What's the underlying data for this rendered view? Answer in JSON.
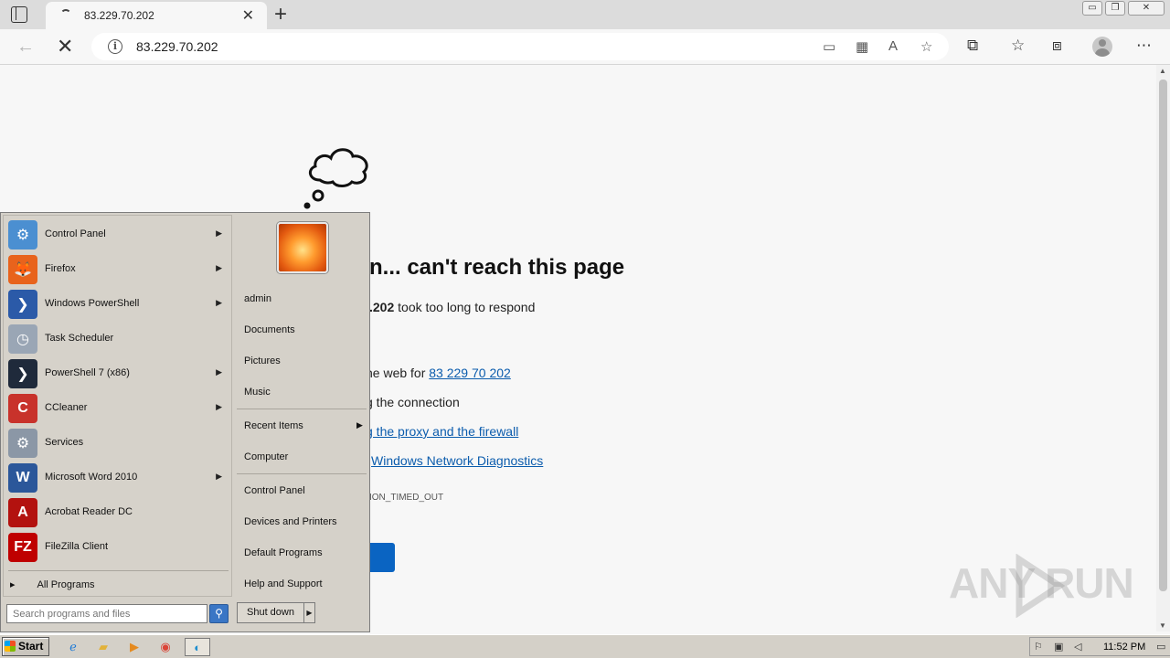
{
  "browser": {
    "tab_title": "83.229.70.202",
    "tab_close": "✕",
    "new_tab": "+",
    "url": "83.229.70.202",
    "window_controls": [
      "▭",
      "❐",
      "✕"
    ]
  },
  "page": {
    "heading": "n... can't reach this page",
    "line1_bold": ".202",
    "line1_rest": " took too long to respond",
    "search_prefix": "ne web for ",
    "search_link": "83 229 70 202",
    "check_connection": "g the connection",
    "proxy_link": "g the proxy and the firewall",
    "diag_link": "Windows Network Diagnostics",
    "error_code": "ION_TIMED_OUT"
  },
  "watermark": "ANY RUN",
  "start_menu": {
    "programs": [
      {
        "label": "Control Panel",
        "icon": "control-panel-icon",
        "color": "#4b8fd1",
        "glyph": "⚙",
        "arrow": true
      },
      {
        "label": "Firefox",
        "icon": "firefox-icon",
        "color": "#e8631c",
        "glyph": "🦊",
        "arrow": true
      },
      {
        "label": "Windows PowerShell",
        "icon": "powershell-icon",
        "color": "#2b5aa8",
        "glyph": "❯",
        "arrow": true
      },
      {
        "label": "Task Scheduler",
        "icon": "clock-icon",
        "color": "#9aa6b5",
        "glyph": "◷",
        "arrow": false
      },
      {
        "label": "PowerShell 7 (x86)",
        "icon": "powershell7-icon",
        "color": "#1f2a3b",
        "glyph": "❯",
        "arrow": true
      },
      {
        "label": "CCleaner",
        "icon": "ccleaner-icon",
        "color": "#c8322b",
        "glyph": "C",
        "arrow": true
      },
      {
        "label": "Services",
        "icon": "gears-icon",
        "color": "#8b97a6",
        "glyph": "⚙",
        "arrow": false
      },
      {
        "label": "Microsoft Word 2010",
        "icon": "word-icon",
        "color": "#2b579a",
        "glyph": "W",
        "arrow": true
      },
      {
        "label": "Acrobat Reader DC",
        "icon": "acrobat-icon",
        "color": "#b3120f",
        "glyph": "A",
        "arrow": false
      },
      {
        "label": "FileZilla Client",
        "icon": "filezilla-icon",
        "color": "#bf0000",
        "glyph": "FZ",
        "arrow": false
      }
    ],
    "all_programs": "All Programs",
    "search_placeholder": "Search programs and files",
    "right": {
      "user": "admin",
      "documents": "Documents",
      "pictures": "Pictures",
      "music": "Music",
      "recent_items": "Recent Items",
      "computer": "Computer",
      "control_panel": "Control Panel",
      "devices": "Devices and Printers",
      "default_programs": "Default Programs",
      "help": "Help and Support"
    },
    "shutdown": "Shut down"
  },
  "taskbar": {
    "start": "Start",
    "apps": [
      "ie-icon",
      "explorer-icon",
      "media-player-icon",
      "chrome-icon",
      "edge-icon"
    ],
    "clock": "11:52 PM"
  }
}
